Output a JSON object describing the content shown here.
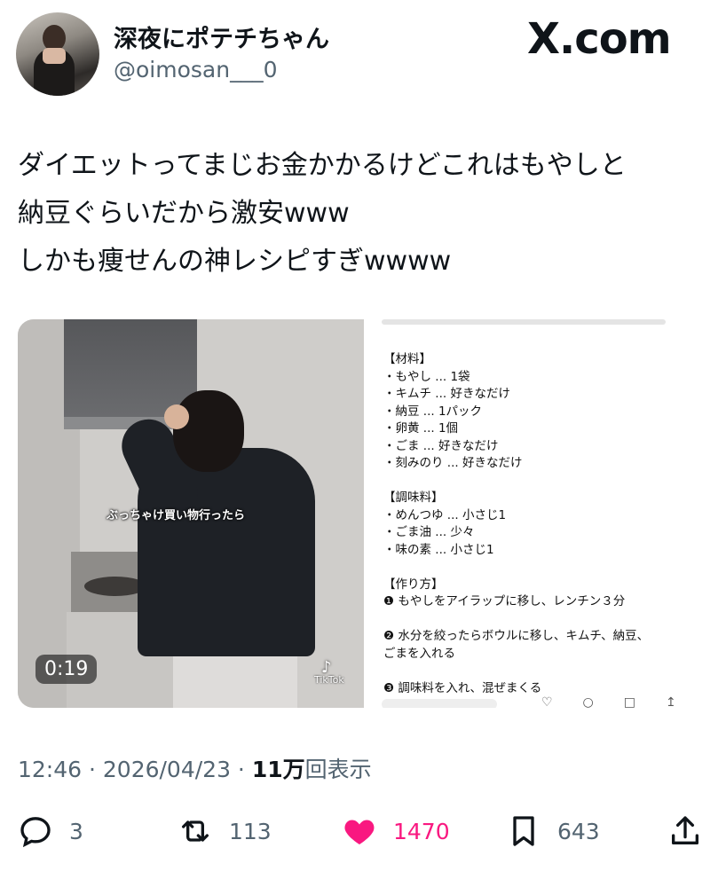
{
  "author": {
    "display_name": "深夜にポテチちゃん",
    "handle": "@oimosan___0"
  },
  "brand": "X.com",
  "tweet": {
    "lines": [
      "ダイエットってまじお金かかるけどこれはもやしと",
      "納豆ぐらいだから激安www",
      "しかも痩せんの神レシピすぎwwww"
    ]
  },
  "video": {
    "caption": "ぶっちゃけ買い物行ったら",
    "duration": "0:19",
    "watermark": "TikTok"
  },
  "recipe": {
    "lines": [
      "【材料】",
      "・もやし ... 1袋",
      "・キムチ ... 好きなだけ",
      "・納豆 ... 1パック",
      "・卵黄 ... 1個",
      "・ごま ... 好きなだけ",
      "・刻みのり ... 好きなだけ",
      "",
      "【調味料】",
      "・めんつゆ ... 小さじ1",
      "・ごま油 ... 少々",
      "・味の素 ... 小さじ1",
      "",
      "【作り方】",
      "❶ もやしをアイラップに移し、レンチン３分",
      "",
      "❷ 水分を絞ったらボウルに移し、キムチ、納豆、",
      "ごまを入れる",
      "",
      "❸ 調味料を入れ、混ぜまくる"
    ]
  },
  "meta": {
    "timestamp": "12:46 · 2026/04/23 · ",
    "views": "11万",
    "views_label": "回表示"
  },
  "actions": {
    "replies": "3",
    "reposts": "113",
    "likes": "1470",
    "bookmarks": "643"
  },
  "colors": {
    "like": "#f91880",
    "secondary_text": "#536471",
    "primary_text": "#0f1419"
  },
  "icons": [
    "reply-icon",
    "repost-icon",
    "heart-icon",
    "bookmark-icon",
    "share-icon",
    "tiktok-icon"
  ]
}
